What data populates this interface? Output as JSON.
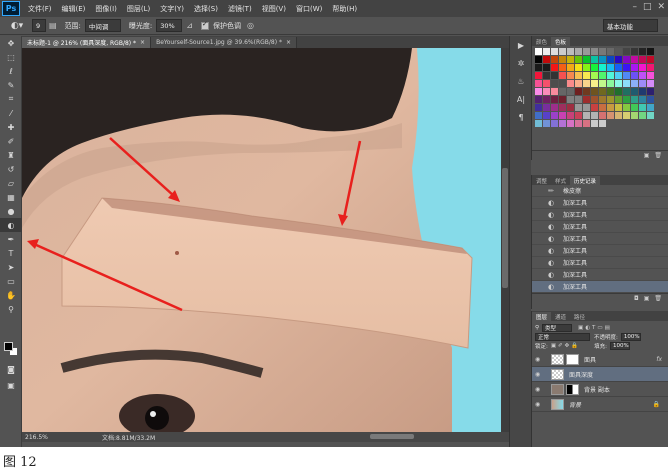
{
  "app": {
    "logo": "Ps"
  },
  "menu": [
    "文件(F)",
    "编辑(E)",
    "图像(I)",
    "图层(L)",
    "文字(Y)",
    "选择(S)",
    "滤镜(T)",
    "视图(V)",
    "窗口(W)",
    "帮助(H)"
  ],
  "window_controls": [
    "–",
    "□",
    "✕"
  ],
  "options": {
    "size": "9",
    "range_label": "范围:",
    "range_value": "中间调",
    "exposure_label": "曝光度:",
    "exposure_value": "30%",
    "protect_label": "保护色调",
    "workspace": "基本功能"
  },
  "tabs": [
    {
      "title": "未标题-1 @ 216% (面具深度, RGB/8) *",
      "close": "×"
    },
    {
      "title": "BeYourself-Source1.jpg @ 39.6%(RGB/8) *",
      "close": "×"
    }
  ],
  "status": {
    "zoom": "216.5%",
    "doc": "文档:8.81M/33.2M"
  },
  "swatches_panel": {
    "tabs": [
      "颜色",
      "色板"
    ]
  },
  "history_panel": {
    "tabs": [
      "调整",
      "样式",
      "历史记录"
    ],
    "items": [
      "橡皮擦",
      "加深工具",
      "加深工具",
      "加深工具",
      "加深工具",
      "加深工具",
      "加深工具",
      "加深工具",
      "加深工具"
    ]
  },
  "layers_panel": {
    "tabs": [
      "图层",
      "通道",
      "路径"
    ],
    "filter_kind": "类型",
    "blend_mode": "正常",
    "opacity_label": "不透明度:",
    "opacity_value": "100%",
    "lock_label": "锁定:",
    "fill_label": "填充:",
    "fill_value": "100%",
    "layers": [
      {
        "name": "面具",
        "fx": "fx"
      },
      {
        "name": "面具深度"
      },
      {
        "name": "背景 副本"
      },
      {
        "name": "背景"
      }
    ]
  },
  "caption": "图 12",
  "colors": {
    "arrow": "#e8201d",
    "sky": "#86dbe9",
    "skin": "#dcb096",
    "selection": "#616e80"
  }
}
